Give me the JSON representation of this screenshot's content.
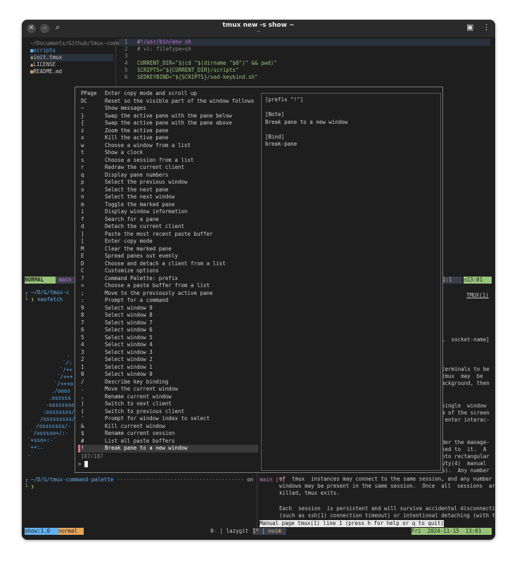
{
  "window": {
    "title": "tmux new -s show ~",
    "subtitle": "~",
    "close_icon": "close-icon",
    "minimize_icon": "minimize-icon",
    "search_icon": "search-icon",
    "split_icon": "split-icon",
    "menu_icon": "kebab-menu-icon"
  },
  "file_tree": {
    "path": "~/Documents/Github/tmux-comm",
    "items": [
      {
        "icon": "folder-icon",
        "name": "scripts"
      },
      {
        "icon": "file-icon",
        "name": "init.tmux"
      },
      {
        "icon": "license-icon",
        "name": "LICENSE"
      },
      {
        "icon": "markdown-icon",
        "name": "README.md"
      }
    ]
  },
  "editor": {
    "lines": [
      {
        "num": "1",
        "text": "#!/usr/bin/env sh"
      },
      {
        "num": "2",
        "text": "# vi: filetype=sh"
      },
      {
        "num": "3",
        "text": ""
      },
      {
        "num": "4",
        "text": "CURRENT_DIR=\"$(cd \"$(dirname \"$0\")\" && pwd)\""
      },
      {
        "num": "5",
        "text": "SCRIPTS=\"${CURRENT_DIR}/scripts\""
      },
      {
        "num": "6",
        "text": "SEDKEYBIND=\"${SCRIPTS}/sed-keybind.sh\""
      }
    ]
  },
  "statusline_top": {
    "mode": "NORMAL",
    "branch": " main",
    "position": "1:1",
    "clock": "13:01"
  },
  "shell_top": {
    "prompt_path": "~/D/G/tmux-c",
    "command": "neofetch"
  },
  "neofetch_art": [
    "-",
    "`/:",
    "`/++",
    "`/+++",
    "`/+++o",
    "./ooos",
    ".osssss",
    "-osssssso",
    ":osssssss/",
    "/ossssssss/",
    "/osssssss/-",
    "`/osssso+/:-",
    "`+sso+:-`",
    "`++:.",
    ".`"
  ],
  "man_page": {
    "header_right": "TMUX(1)",
    "snippets": [
      {
        "id": "s1",
        "text": "L  socket-name]"
      },
      {
        "id": "s2",
        "text": "terminals to be"
      },
      {
        "id": "s3",
        "text": "tmux  may  be"
      },
      {
        "id": "s4",
        "text": "ackground, then"
      },
      {
        "id": "s5",
        "text": "single  window"
      },
      {
        "id": "s6",
        "text": "m of the screen"
      },
      {
        "id": "s7",
        "text": " enter interac-"
      },
      {
        "id": "s8",
        "text": "der the manage-"
      },
      {
        "id": "s9",
        "text": "ked to  it.  A"
      },
      {
        "id": "s10",
        "text": "nto rectangular"
      },
      {
        "id": "s11",
        "text": "pty(4)  manual"
      },
      {
        "id": "s12",
        "text": "s).  Any number"
      }
    ],
    "para1": [
      "of  tmux  instances may connect to the same session, and any number",
      "windows may be present in the same session.  Once  all  sessions  are",
      "killed, tmux exits."
    ],
    "para2": [
      "Each  session  is persistent and will survive accidental disconnection",
      "(such as ssh(1) connection timeout) or intentional detaching (with the"
    ],
    "status": "Manual page tmux(1) line 1 (press h for help or q to quit)"
  },
  "shell_bottom": {
    "prompt_path": "~/D/G/tmux-command-palette",
    "on": "on",
    "branch": " main",
    "flags": "[?]",
    "prompt": "❯"
  },
  "tmux_status": {
    "session": "show:1.0",
    "mode": "normal",
    "win0": "0- | lazygit",
    "win1": "1* | nvim",
    "date": "Fri  2024-11-15  13:01"
  },
  "palette": {
    "count": "187/187",
    "prompt": ">",
    "items": [
      {
        "key": "PPage",
        "desc": "Enter copy mode and scroll up"
      },
      {
        "key": "DC",
        "desc": "Reset so the visible part of the window follows t…"
      },
      {
        "key": "~",
        "desc": "Show messages"
      },
      {
        "key": "}",
        "desc": "Swap the active pane with the pane below"
      },
      {
        "key": "{",
        "desc": "Swap the active pane with the pane above"
      },
      {
        "key": "z",
        "desc": "Zoom the active pane"
      },
      {
        "key": "x",
        "desc": "Kill the active pane"
      },
      {
        "key": "w",
        "desc": "Choose a window from a list"
      },
      {
        "key": "t",
        "desc": "Show a clock"
      },
      {
        "key": "s",
        "desc": "Choose a session from a list"
      },
      {
        "key": "r",
        "desc": "Redraw the current client"
      },
      {
        "key": "q",
        "desc": "Display pane numbers"
      },
      {
        "key": "p",
        "desc": "Select the previous window"
      },
      {
        "key": "o",
        "desc": "Select the next pane"
      },
      {
        "key": "n",
        "desc": "Select the next window"
      },
      {
        "key": "m",
        "desc": "Toggle the marked pane"
      },
      {
        "key": "i",
        "desc": "Display window information"
      },
      {
        "key": "f",
        "desc": "Search for a pane"
      },
      {
        "key": "d",
        "desc": "Detach the current client"
      },
      {
        "key": "]",
        "desc": "Paste the most recent paste buffer"
      },
      {
        "key": "[",
        "desc": "Enter copy mode"
      },
      {
        "key": "M",
        "desc": "Clear the marked pane"
      },
      {
        "key": "E",
        "desc": "Spread panes out evenly"
      },
      {
        "key": "D",
        "desc": "Choose and detach a client from a list"
      },
      {
        "key": "C",
        "desc": "Customize options"
      },
      {
        "key": "?",
        "desc": "Command Palette: prefix"
      },
      {
        "key": "=",
        "desc": "Choose a paste buffer from a list"
      },
      {
        "key": ";",
        "desc": "Move to the previously active pane"
      },
      {
        "key": ":",
        "desc": "Prompt for a command"
      },
      {
        "key": "9",
        "desc": "Select window 9"
      },
      {
        "key": "8",
        "desc": "Select window 8"
      },
      {
        "key": "7",
        "desc": "Select window 7"
      },
      {
        "key": "6",
        "desc": "Select window 6"
      },
      {
        "key": "5",
        "desc": "Select window 5"
      },
      {
        "key": "4",
        "desc": "Select window 4"
      },
      {
        "key": "3",
        "desc": "Select window 3"
      },
      {
        "key": "2",
        "desc": "Select window 2"
      },
      {
        "key": "1",
        "desc": "Select window 1"
      },
      {
        "key": "0",
        "desc": "Select window 0"
      },
      {
        "key": "/",
        "desc": "Describe key binding"
      },
      {
        "key": ".",
        "desc": "Move the current window"
      },
      {
        "key": ",",
        "desc": "Rename current window"
      },
      {
        "key": ")",
        "desc": "Switch to next client"
      },
      {
        "key": "(",
        "desc": "Switch to previous client"
      },
      {
        "key": "'",
        "desc": "Prompt for window index to select"
      },
      {
        "key": "&",
        "desc": "Kill current window"
      },
      {
        "key": "$",
        "desc": "Rename current session"
      },
      {
        "key": "#",
        "desc": "List all paste buffers"
      },
      {
        "key": "!",
        "desc": "Break pane to a new window"
      }
    ],
    "preview": {
      "keyline": "[prefix \"!\"]",
      "note_label": "[Note]",
      "note": "Break pane to a new window",
      "bind_label": "[Bind]",
      "bind": "break-pane"
    }
  }
}
